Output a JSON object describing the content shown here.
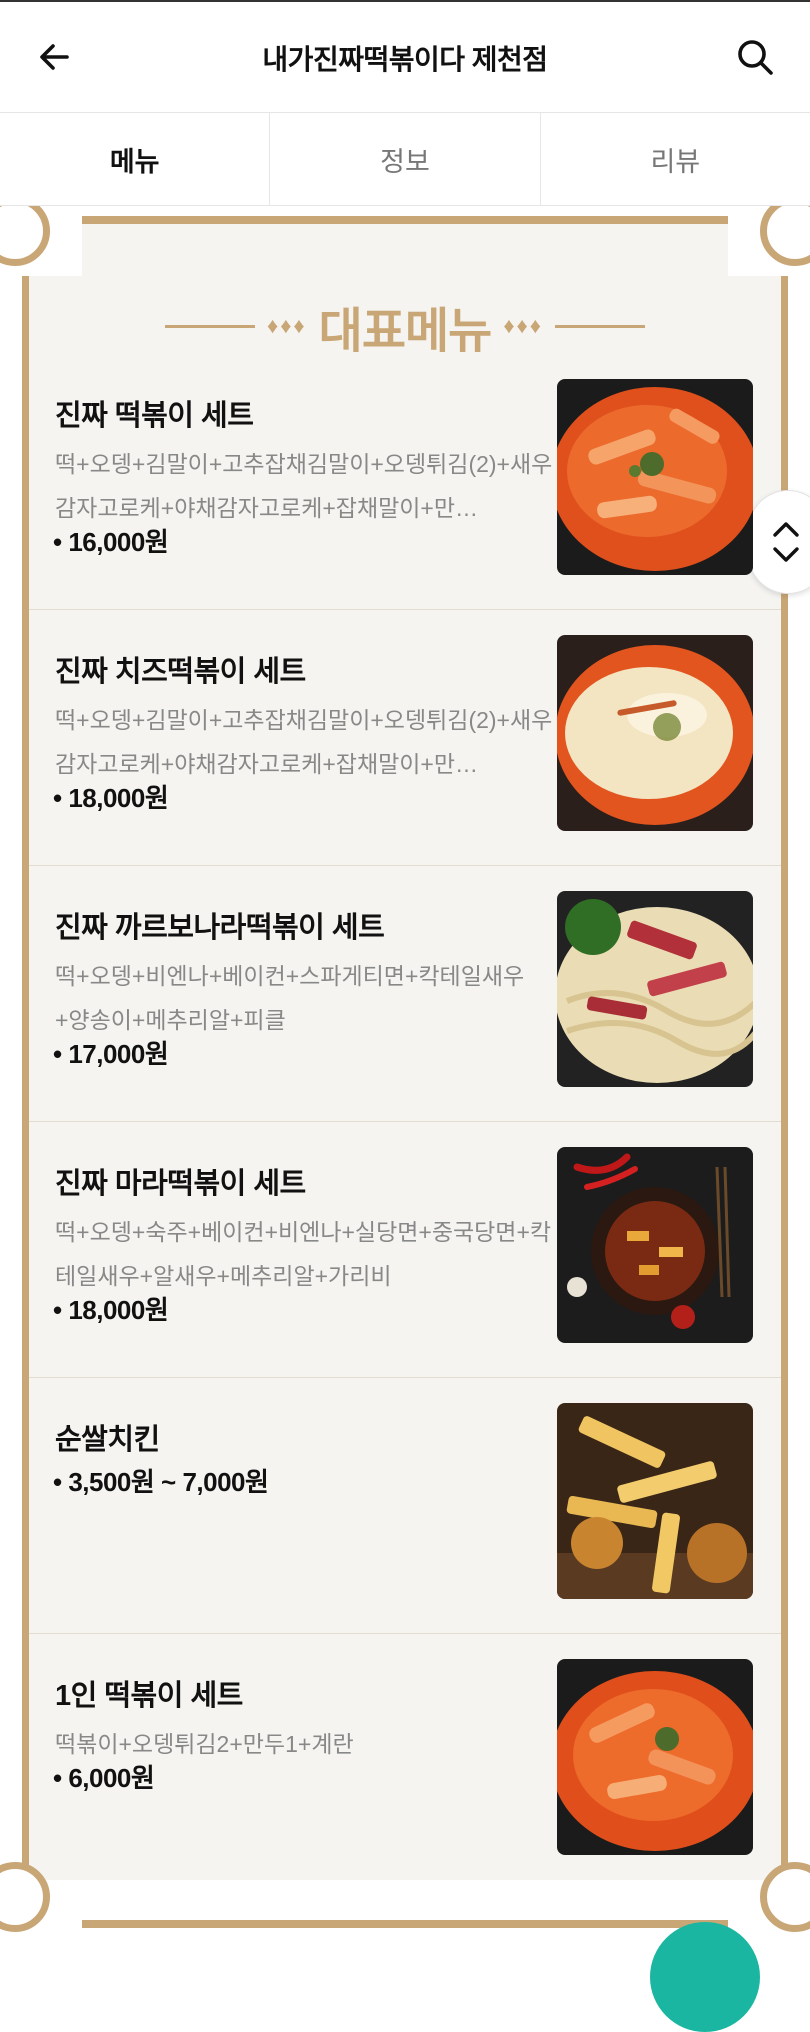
{
  "header": {
    "title": "내가진짜떡볶이다 제천점"
  },
  "tabs": [
    {
      "label": "메뉴",
      "active": true
    },
    {
      "label": "정보",
      "active": false
    },
    {
      "label": "리뷰",
      "active": false
    }
  ],
  "section": {
    "title": "대표메뉴",
    "ornament": "♦♦♦"
  },
  "menu": [
    {
      "name": "진짜 떡볶이 세트",
      "desc": "떡+오뎅+김말이+고추잡채김말이+오뎅튀김(2)+새우감자고로케+야채감자고로케+잡채말이+만…",
      "price": "• 16,000원",
      "image": "tteokbokki-red"
    },
    {
      "name": "진짜 치즈떡볶이 세트",
      "desc": "떡+오뎅+김말이+고추잡채김말이+오뎅튀김(2)+새우감자고로케+야채감자고로케+잡채말이+만…",
      "price": "• 18,000원",
      "image": "cheese-tteokbokki"
    },
    {
      "name": "진짜 까르보나라떡볶이 세트",
      "desc": "떡+오뎅+비엔나+베이컨+스파게티면+칵테일새우+양송이+메추리알+피클",
      "price": "• 17,000원",
      "image": "carbonara-tteokbokki"
    },
    {
      "name": "진짜 마라떡볶이 세트",
      "desc": "떡+오뎅+숙주+베이컨+비엔나+실당면+중국당면+칵테일새우+알새우+메추리알+가리비",
      "price": "• 18,000원",
      "image": "mala-tteokbokki"
    },
    {
      "name": "순쌀치킨",
      "desc": "",
      "price": "• 3,500원 ~ 7,000원",
      "image": "fried-chicken"
    },
    {
      "name": "1인 떡볶이 세트",
      "desc": "떡볶이+오뎅튀김2+만두1+계란",
      "price": "• 6,000원",
      "image": "single-tteokbokki"
    }
  ],
  "colors": {
    "accent": "#c9a676",
    "background": "#f5f4f1",
    "fab": "#1bb6a1"
  }
}
